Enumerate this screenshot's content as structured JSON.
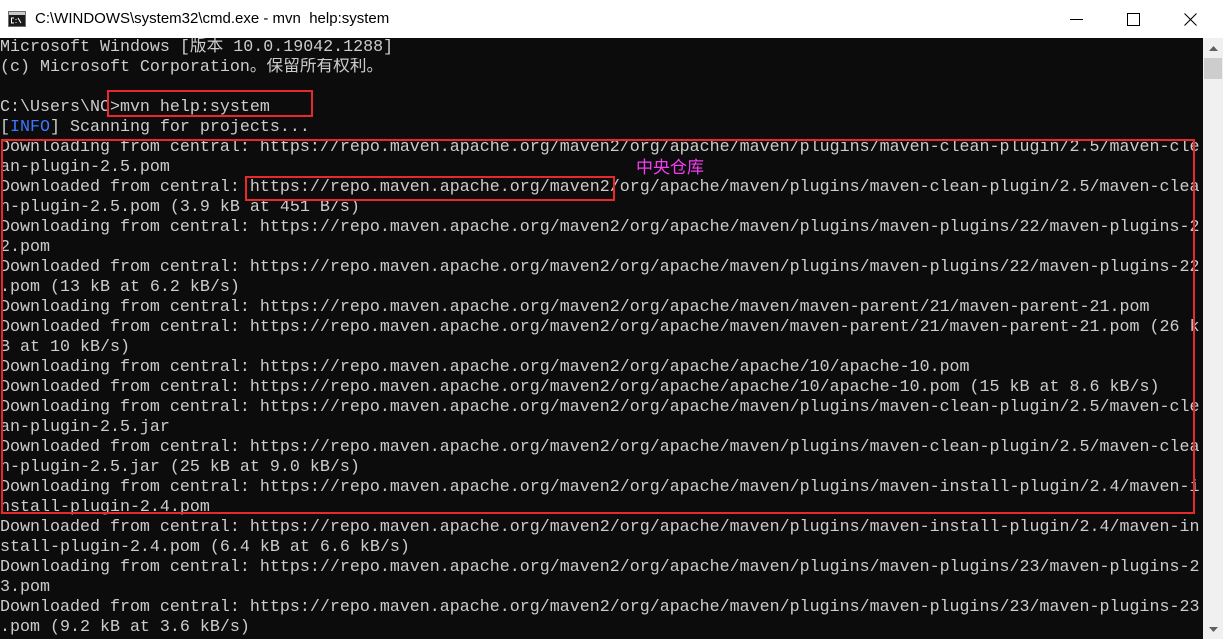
{
  "window": {
    "title": "C:\\WINDOWS\\system32\\cmd.exe - mvn  help:system",
    "app_icon": "cmd-icon",
    "controls": {
      "minimize_icon": "minimize-icon",
      "maximize_icon": "maximize-icon",
      "close_icon": "close-icon"
    }
  },
  "console": {
    "colors": {
      "background": "#0c0c0c",
      "foreground": "#cccccc",
      "info_tag": "#3b78ff"
    },
    "lines": [
      "Microsoft Windows [版本 10.0.19042.1288]",
      "(c) Microsoft Corporation。保留所有权利。",
      "",
      "C:\\Users\\NC>mvn help:system",
      {
        "open": "[",
        "tag": "INFO",
        "close": "] Scanning for projects..."
      },
      "Downloading from central: https://repo.maven.apache.org/maven2/org/apache/maven/plugins/maven-clean-plugin/2.5/maven-cle",
      "an-plugin-2.5.pom",
      "Downloaded from central: https://repo.maven.apache.org/maven2/org/apache/maven/plugins/maven-clean-plugin/2.5/maven-clea",
      "n-plugin-2.5.pom (3.9 kB at 451 B/s)",
      "Downloading from central: https://repo.maven.apache.org/maven2/org/apache/maven/plugins/maven-plugins/22/maven-plugins-2",
      "2.pom",
      "Downloaded from central: https://repo.maven.apache.org/maven2/org/apache/maven/plugins/maven-plugins/22/maven-plugins-22",
      ".pom (13 kB at 6.2 kB/s)",
      "Downloading from central: https://repo.maven.apache.org/maven2/org/apache/maven/maven-parent/21/maven-parent-21.pom",
      "Downloaded from central: https://repo.maven.apache.org/maven2/org/apache/maven/maven-parent/21/maven-parent-21.pom (26 k",
      "B at 10 kB/s)",
      "Downloading from central: https://repo.maven.apache.org/maven2/org/apache/apache/10/apache-10.pom",
      "Downloaded from central: https://repo.maven.apache.org/maven2/org/apache/apache/10/apache-10.pom (15 kB at 8.6 kB/s)",
      "Downloading from central: https://repo.maven.apache.org/maven2/org/apache/maven/plugins/maven-clean-plugin/2.5/maven-cle",
      "an-plugin-2.5.jar",
      "Downloaded from central: https://repo.maven.apache.org/maven2/org/apache/maven/plugins/maven-clean-plugin/2.5/maven-clea",
      "n-plugin-2.5.jar (25 kB at 9.0 kB/s)",
      "Downloading from central: https://repo.maven.apache.org/maven2/org/apache/maven/plugins/maven-install-plugin/2.4/maven-i",
      "nstall-plugin-2.4.pom",
      "Downloaded from central: https://repo.maven.apache.org/maven2/org/apache/maven/plugins/maven-install-plugin/2.4/maven-in",
      "stall-plugin-2.4.pom (6.4 kB at 6.6 kB/s)",
      "Downloading from central: https://repo.maven.apache.org/maven2/org/apache/maven/plugins/maven-plugins/23/maven-plugins-2",
      "3.pom",
      "Downloaded from central: https://repo.maven.apache.org/maven2/org/apache/maven/plugins/maven-plugins/23/maven-plugins-23",
      ".pom (9.2 kB at 3.6 kB/s)"
    ]
  },
  "annotations": {
    "label": "中央仓库",
    "label_color": "#f43df4",
    "box_color": "#e8292b"
  },
  "scrollbar": {
    "scroll_fraction": 0,
    "up_icon": "scroll-up-arrow-icon",
    "down_icon": "scroll-down-arrow-icon"
  }
}
